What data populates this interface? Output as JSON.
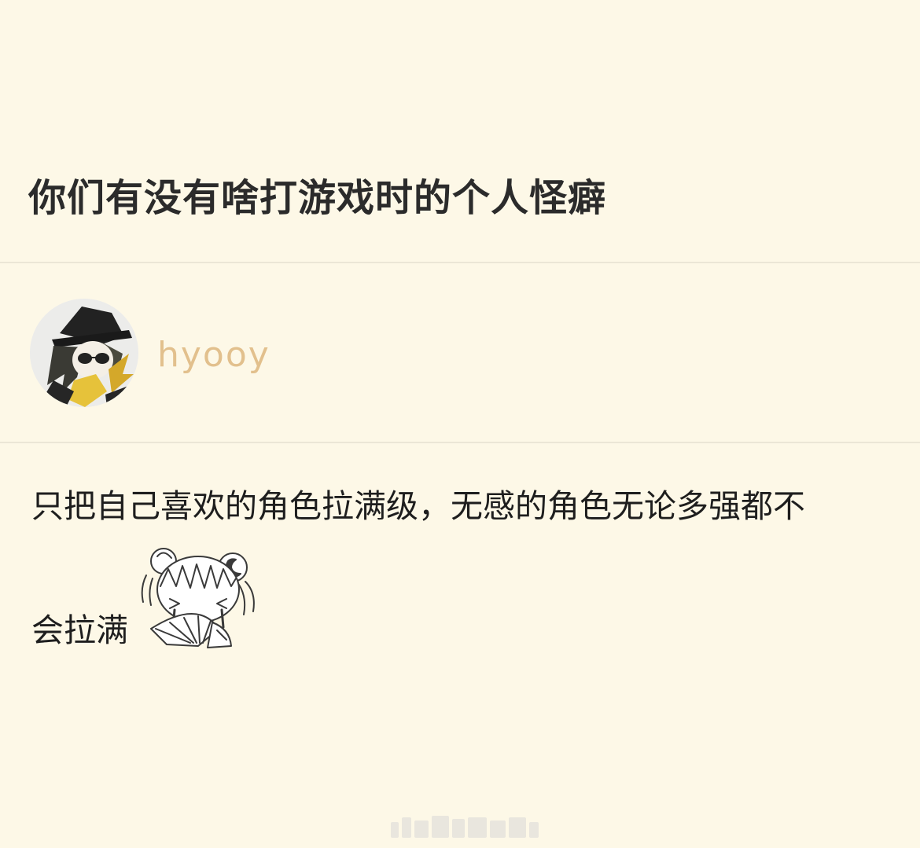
{
  "post": {
    "title": "你们有没有啥打游戏时的个人怪癖"
  },
  "author": {
    "username": "hyooy",
    "avatar_icon": "anime-character-avatar"
  },
  "content": {
    "line1": "只把自己喜欢的角色拉满级，无感的角色无论多强都不",
    "line2": "会拉满",
    "sticker_icon": "chibi-girl-crying-with-fan-sticker"
  },
  "colors": {
    "background": "#fdf8e7",
    "title": "#2b2b2b",
    "username": "#e2c08d",
    "body_text": "#1e1e1e",
    "divider": "#ebe6d6"
  }
}
